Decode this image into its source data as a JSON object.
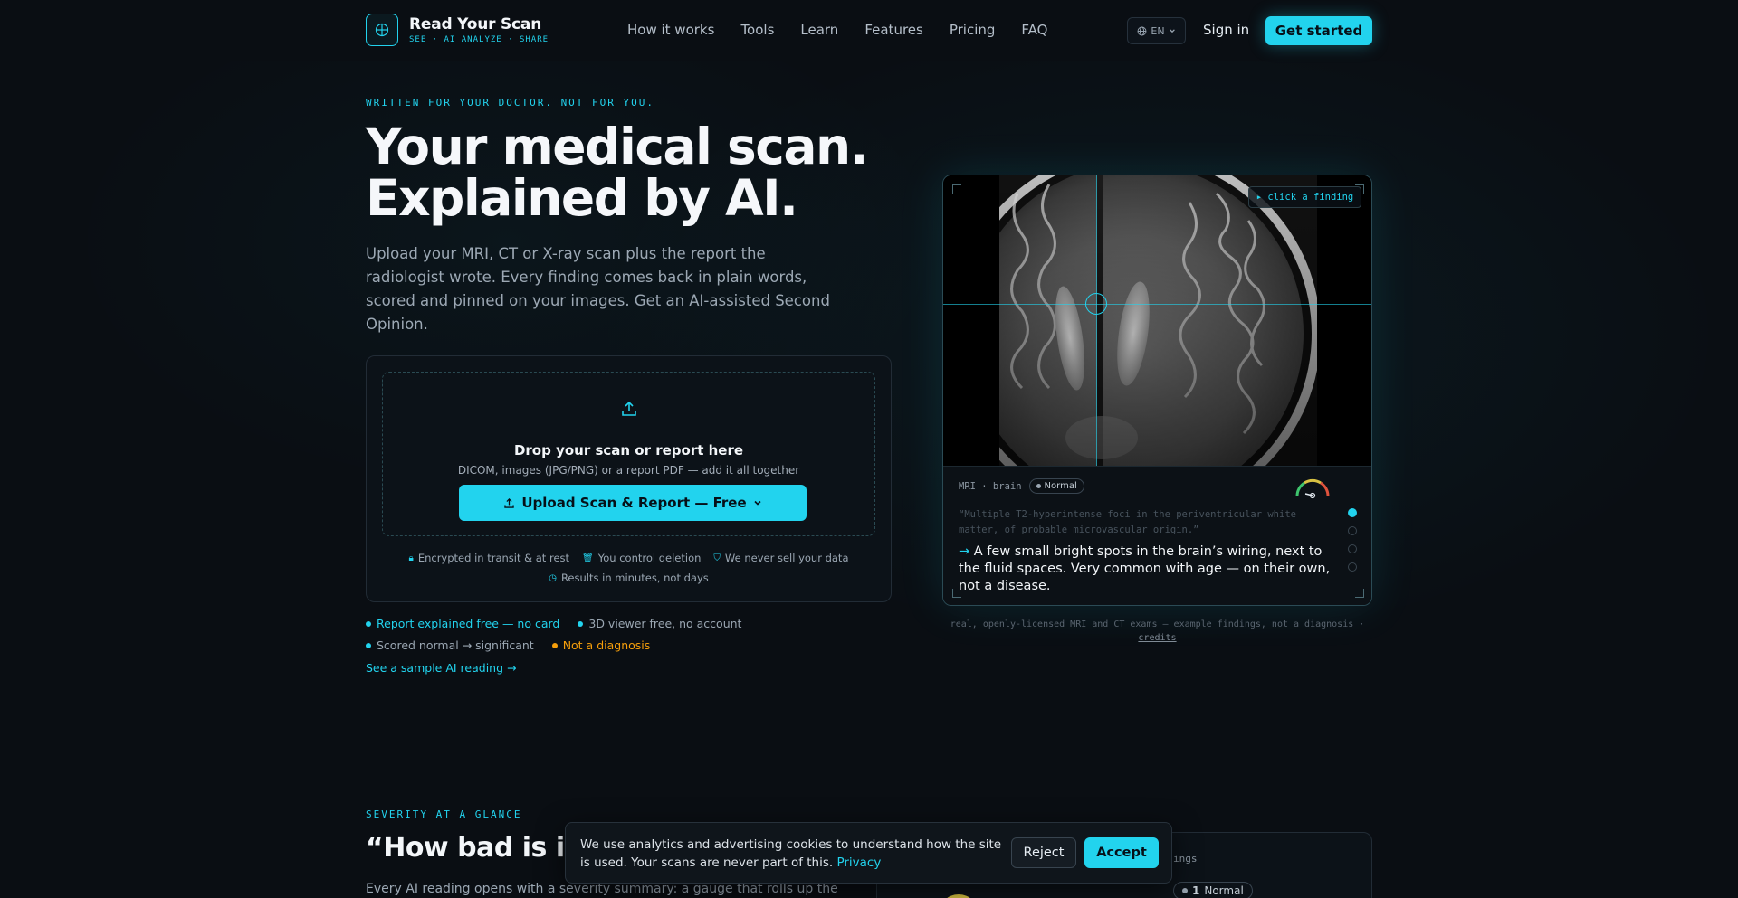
{
  "brand": {
    "name": "Read Your Scan",
    "tagline": "SEE · AI ANALYZE · SHARE"
  },
  "nav": {
    "links": [
      "How it works",
      "Tools",
      "Learn",
      "Features",
      "Pricing",
      "FAQ"
    ],
    "language": "EN",
    "signin": "Sign in",
    "cta": "Get started"
  },
  "hero": {
    "eyebrow": "WRITTEN FOR YOUR DOCTOR. NOT FOR YOU.",
    "title_line1": "Your medical scan.",
    "title_line2": "Explained by AI.",
    "subtitle": "Upload your MRI, CT or X-ray scan plus the report the radiologist wrote. Every finding comes back in plain words, scored and pinned on your images. Get an AI-assisted Second Opinion."
  },
  "upload": {
    "title": "Drop your scan or report here",
    "subtitle": "DICOM, images (JPG/PNG) or a report PDF — add it all together",
    "button": "Upload Scan & Report — Free",
    "trust": [
      "Encrypted in transit & at rest",
      "You control deletion",
      "We never sell your data",
      "Results in minutes, not days"
    ]
  },
  "bullets": {
    "row1": [
      {
        "text": "Report explained free — no card",
        "color": "#22d3ee",
        "text_color": "#22d3ee"
      },
      {
        "text": "3D viewer free, no account",
        "color": "#22d3ee",
        "text_color": "#9aa6b2"
      }
    ],
    "row2": [
      {
        "text": "Scored normal → significant",
        "color": "#22d3ee",
        "text_color": "#9aa6b2"
      },
      {
        "text": "Not a diagnosis",
        "color": "#f59e0b",
        "text_color": "#f59e0b"
      }
    ],
    "sample_link": "See a sample AI reading →"
  },
  "viewer": {
    "hint": "▸ click a finding",
    "modality": "MRI · brain",
    "badge": "Normal",
    "quote": "“Multiple T2-hyperintense foci in the periventricular white matter, of probable microvascular origin.”",
    "plain": "A few small bright spots in the brain’s wiring, next to the fluid spaces. Very common with age — on their own, not a disease.",
    "arrow": "→",
    "caption": "real, openly-licensed MRI and CT exams — example findings, not a diagnosis ·",
    "credits": "credits"
  },
  "severity": {
    "eyebrow": "SEVERITY AT A GLANCE",
    "title": "“How bad is it?”",
    "subtitle": "Every AI reading opens with a severity summary: a gauge that rolls up the",
    "card_label": "ings",
    "badge_count": "1",
    "badge_label": "Normal"
  },
  "cookie": {
    "text": "We use analytics and advertising cookies to understand how the site is used. Your scans are never part of this.",
    "link": "Privacy",
    "reject": "Reject",
    "accept": "Accept"
  },
  "colors": {
    "accent": "#22d3ee",
    "warning": "#f59e0b",
    "background": "#0a0e13"
  }
}
